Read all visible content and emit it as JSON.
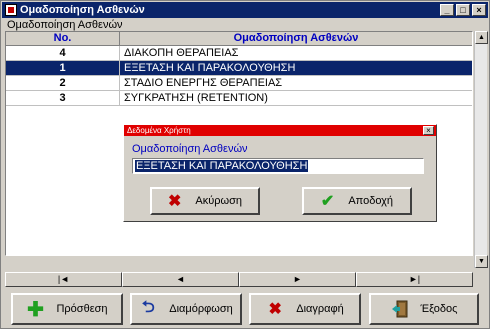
{
  "window": {
    "title": "Ομαδοποίηση Ασθενών"
  },
  "section_label": "Ομαδοποίηση Ασθενών",
  "table": {
    "headers": [
      "No.",
      "Ομαδοποίηση Ασθενών"
    ],
    "rows": [
      {
        "no": "4",
        "name": "ΔΙΑΚΟΠΗ ΘΕΡΑΠΕΙΑΣ",
        "selected": false
      },
      {
        "no": "1",
        "name": "ΕΞΕΤΑΣΗ ΚΑΙ ΠΑΡΑΚΟΛΟΥΘΗΣΗ",
        "selected": true
      },
      {
        "no": "2",
        "name": "ΣΤΑΔΙΟ ΕΝΕΡΓΗΣ ΘΕΡΑΠΕΙΑΣ",
        "selected": false
      },
      {
        "no": "3",
        "name": "ΣΥΓΚΡΑΤΗΣΗ (RETENTION)",
        "selected": false
      }
    ]
  },
  "navigator": [
    "|◄",
    "◄",
    "►",
    "►|"
  ],
  "buttons": {
    "add": "Πρόσθεση",
    "edit": "Διαμόρφωση",
    "delete": "Διαγραφή",
    "exit": "Έξοδος"
  },
  "dialog": {
    "title": "Δεδομένα Χρήστη",
    "label": "Ομαδοποίηση Ασθενών",
    "value": "ΕΞΕΤΑΣΗ ΚΑΙ ΠΑΡΑΚΟΛΟΥΘΗΣΗ",
    "cancel": "Ακύρωση",
    "accept": "Αποδοχή"
  },
  "colors": {
    "selection": "#0a246a",
    "dialog_title": "#e00000",
    "header_text": "#0000c0"
  },
  "icons": [
    "app-icon",
    "plus-icon",
    "edit-icon",
    "delete-x-icon",
    "exit-door-icon",
    "cancel-x-icon",
    "check-icon"
  ]
}
